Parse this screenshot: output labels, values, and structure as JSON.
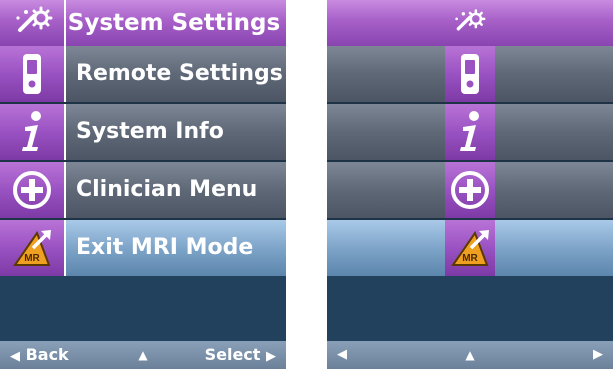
{
  "left_screen": {
    "header": {
      "title": "System Settings",
      "icon": "settings-wand-icon"
    },
    "menu": [
      {
        "label": "Remote Settings",
        "icon": "remote-control-icon",
        "selected": false
      },
      {
        "label": "System Info",
        "icon": "info-icon",
        "selected": false
      },
      {
        "label": "Clinician Menu",
        "icon": "medical-cross-icon",
        "selected": false
      },
      {
        "label": "Exit MRI Mode",
        "icon": "mri-exit-icon",
        "selected": true
      }
    ],
    "footer": {
      "back_label": "Back",
      "back_glyph": "◀",
      "up_glyph": "▲",
      "select_label": "Select",
      "select_glyph": "▶"
    }
  },
  "right_screen": {
    "header": {
      "icon": "settings-wand-icon"
    },
    "menu": [
      {
        "icon": "remote-control-icon",
        "selected": false
      },
      {
        "icon": "info-icon",
        "selected": false
      },
      {
        "icon": "medical-cross-icon",
        "selected": false
      },
      {
        "icon": "mri-exit-icon",
        "selected": true
      }
    ],
    "footer": {
      "left_glyph": "◀",
      "up_glyph": "▲",
      "right_glyph": "▶"
    }
  },
  "mri_badge_text": "MR",
  "colors": {
    "header_purple": "#a660c8",
    "row_gray": "#5f6877",
    "row_selected_blue": "#7aa1c6",
    "background_navy": "#22415c",
    "footer_blue_gray": "#7a90a8",
    "mri_badge_orange": "#f0a020"
  }
}
